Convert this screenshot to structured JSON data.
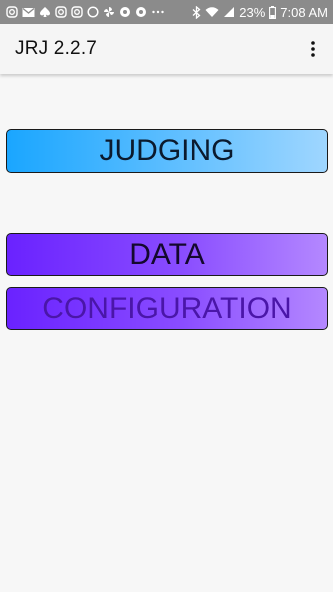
{
  "status_bar": {
    "battery_percent": "23%",
    "time": "7:08 AM",
    "background_color": "#8b8b8b",
    "left_icons": [
      "instagram-icon",
      "gmail-icon",
      "spade-icon",
      "instagram-icon",
      "instagram-icon",
      "circle-icon",
      "pinwheel-icon",
      "chrome-icon",
      "chrome-icon",
      "more-dots-icon"
    ],
    "right_icons": [
      "bluetooth-icon",
      "wifi-icon",
      "signal-icon",
      "battery-icon"
    ]
  },
  "app_bar": {
    "title": "JRJ 2.2.7",
    "menu_icon": "overflow-menu-icon"
  },
  "menu": {
    "judging_label": "JUDGING",
    "data_label": "DATA",
    "configuration_label": "CONFIGURATION"
  },
  "colors": {
    "judging_gradient": [
      "#1aa6ff",
      "#9fd6ff"
    ],
    "data_gradient": [
      "#6a22ff",
      "#b488ff"
    ],
    "configuration_text": "#4a16a8"
  }
}
